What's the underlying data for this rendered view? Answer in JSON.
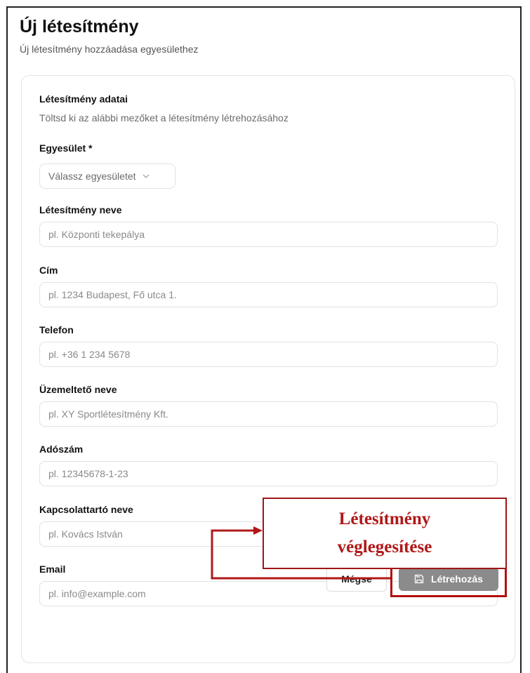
{
  "header": {
    "title": "Új létesítmény",
    "subtitle": "Új létesítmény hozzáadása egyesülethez"
  },
  "card": {
    "title": "Létesítmény adatai",
    "description": "Töltsd ki az alábbi mezőket a létesítmény létrehozásához"
  },
  "form": {
    "club": {
      "label": "Egyesület *",
      "value": "Válassz egyesületet",
      "icon": "chevron-down-icon"
    },
    "facility_name": {
      "label": "Létesítmény neve",
      "placeholder": "pl. Központi tekepálya",
      "value": ""
    },
    "address": {
      "label": "Cím",
      "placeholder": "pl. 1234 Budapest, Fő utca 1.",
      "value": ""
    },
    "phone": {
      "label": "Telefon",
      "placeholder": "pl. +36 1 234 5678",
      "value": ""
    },
    "operator_name": {
      "label": "Üzemeltető neve",
      "placeholder": "pl. XY Sportlétesítmény Kft.",
      "value": ""
    },
    "tax_number": {
      "label": "Adószám",
      "placeholder": "pl. 12345678-1-23",
      "value": ""
    },
    "contact_name": {
      "label": "Kapcsolattartó neve",
      "placeholder": "pl. Kovács István",
      "value": ""
    },
    "email": {
      "label": "Email",
      "placeholder": "pl. info@example.com",
      "value": ""
    }
  },
  "actions": {
    "cancel_label": "Mégse",
    "create_label": "Létrehozás",
    "create_icon": "save-icon"
  },
  "annotation": {
    "line1": "Létesítmény",
    "line2": "véglegesítése",
    "color": "#b01818"
  }
}
